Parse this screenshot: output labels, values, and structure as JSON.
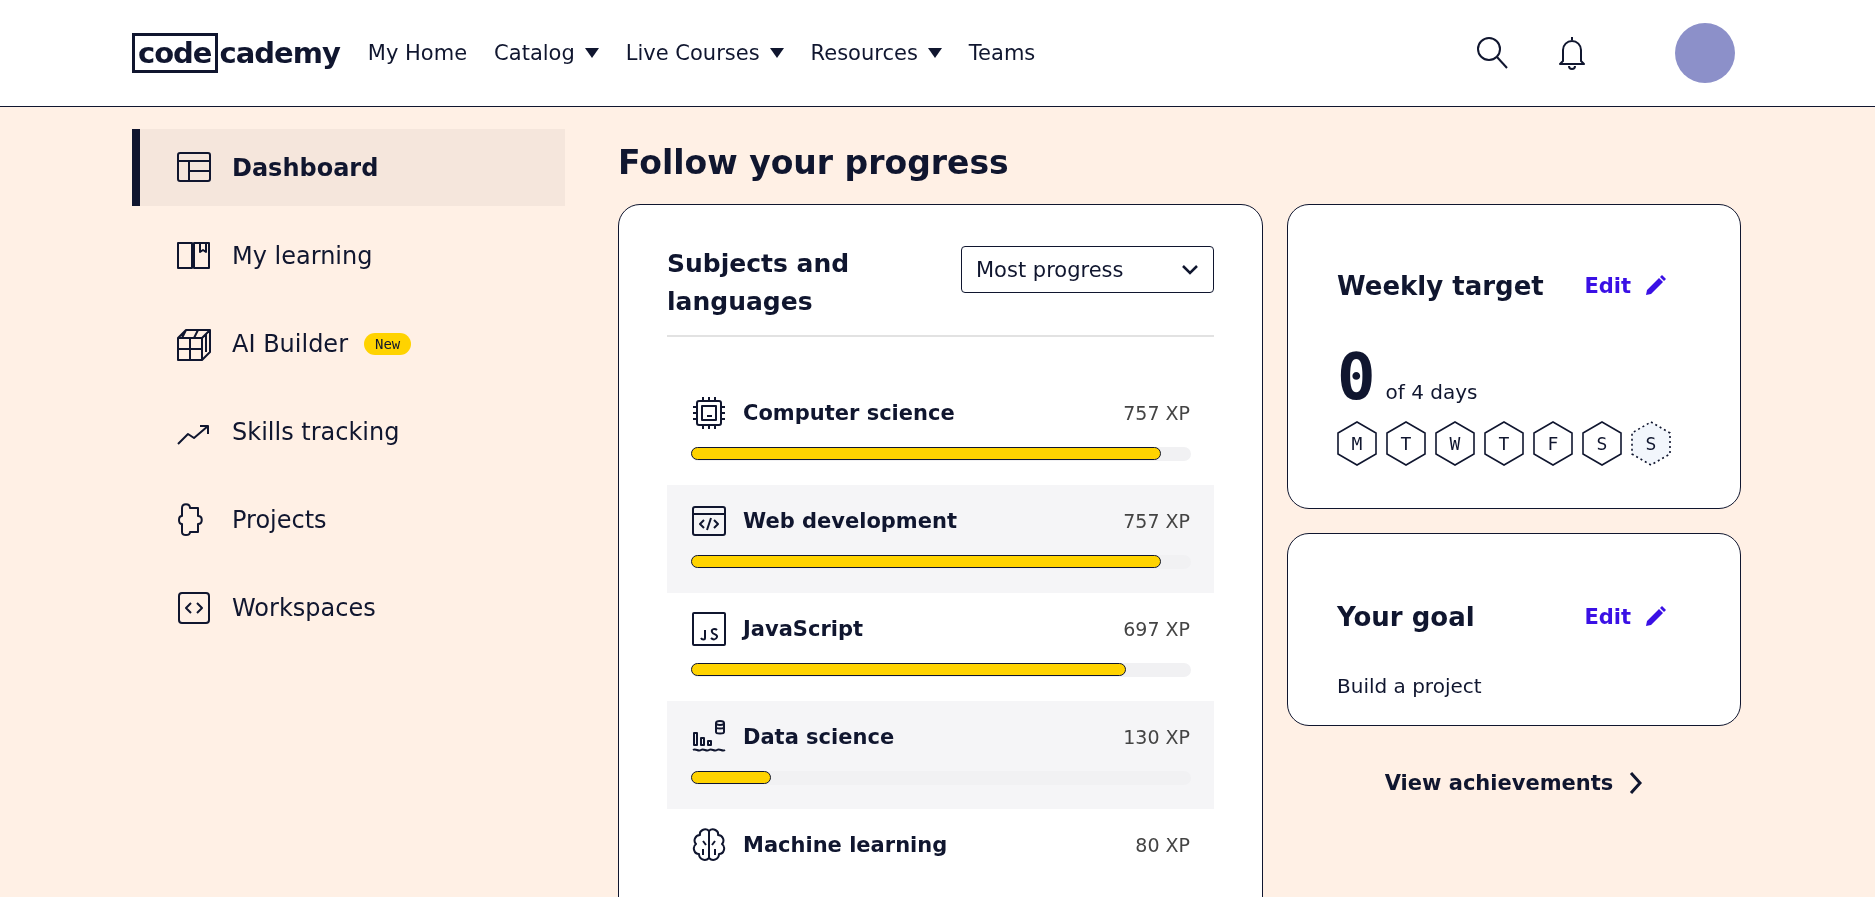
{
  "header": {
    "logo": {
      "boxed": "code",
      "rest": "cademy"
    },
    "nav": [
      {
        "label": "My Home",
        "dropdown": false
      },
      {
        "label": "Catalog",
        "dropdown": true
      },
      {
        "label": "Live Courses",
        "dropdown": true
      },
      {
        "label": "Resources",
        "dropdown": true
      },
      {
        "label": "Teams",
        "dropdown": false
      }
    ]
  },
  "sidebar": {
    "items": [
      {
        "label": "Dashboard",
        "selected": true
      },
      {
        "label": "My learning",
        "selected": false
      },
      {
        "label": "AI Builder",
        "selected": false,
        "badge": "New"
      },
      {
        "label": "Skills tracking",
        "selected": false
      },
      {
        "label": "Projects",
        "selected": false
      },
      {
        "label": "Workspaces",
        "selected": false
      }
    ]
  },
  "page_title": "Follow your progress",
  "subjects": {
    "title": "Subjects and languages",
    "sort": {
      "value": "Most progress"
    },
    "rows": [
      {
        "name": "Computer science",
        "xp": "757 XP",
        "level": 0.94
      },
      {
        "name": "Web development",
        "xp": "757 XP",
        "level": 0.94
      },
      {
        "name": "JavaScript",
        "xp": "697 XP",
        "level": 0.87
      },
      {
        "name": "Data science",
        "xp": "130 XP",
        "level": 0.16
      },
      {
        "name": "Machine learning",
        "xp": "80 XP"
      }
    ]
  },
  "weekly_target": {
    "title": "Weekly target",
    "edit": "Edit",
    "count": "0",
    "of": "of 4 days",
    "days": [
      {
        "label": "M",
        "today": false
      },
      {
        "label": "T",
        "today": false
      },
      {
        "label": "W",
        "today": false
      },
      {
        "label": "T",
        "today": false
      },
      {
        "label": "F",
        "today": false
      },
      {
        "label": "S",
        "today": false
      },
      {
        "label": "S",
        "today": true
      }
    ]
  },
  "goal": {
    "title": "Your goal",
    "edit": "Edit",
    "text": "Build a project"
  },
  "achievements_link": "View achievements"
}
